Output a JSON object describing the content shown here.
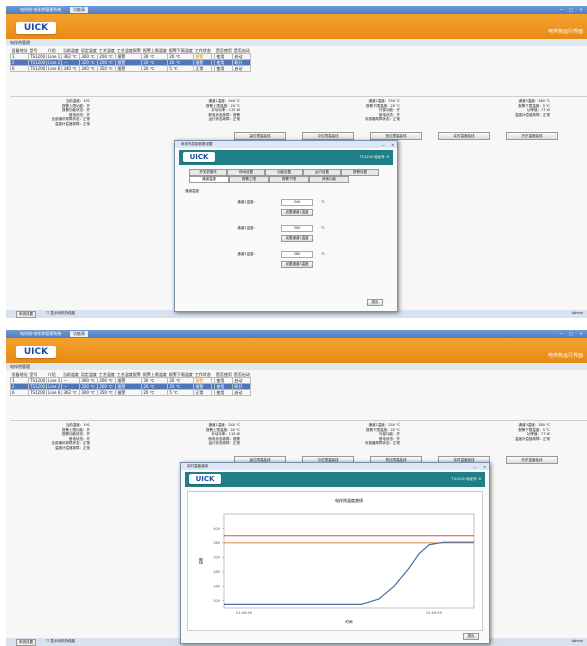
{
  "window": {
    "title": "电伴热·电伴热管理系统",
    "tab": "功能表",
    "controls": [
      "—",
      "□",
      "×"
    ]
  },
  "header": {
    "logo": "UICK",
    "right_text": "电伴热运行界面"
  },
  "page_label": "电伴热管理",
  "table": {
    "headers": [
      "设备地址",
      "型号",
      "介绍",
      "当前温度",
      "设定温度",
      "工艺温度",
      "工艺温度报警",
      "报警上限温度",
      "报警下限温度",
      "工作状态",
      "",
      "是否使用",
      "是否启动"
    ],
    "rows_1": [
      [
        "1",
        "TS1200",
        "Line 1",
        "362 ℃",
        "300 ℃",
        "200 ℃",
        "报警",
        "30 ℃",
        "20 ℃",
        "报警",
        "",
        "使用",
        "启动"
      ],
      [
        "2",
        "TS1200",
        "Line 2",
        "—",
        "320 ℃",
        "200 ℃",
        "报警",
        "20 ℃",
        "20 ℃",
        "报警",
        "",
        "使用",
        "断开"
      ],
      [
        "6",
        "TS1200",
        "Line 6",
        "340 ℃",
        "340 ℃",
        "350 ℃",
        "报警",
        "20 ℃",
        "5 ℃",
        "正常",
        "",
        "使用",
        "启动"
      ]
    ],
    "rows_2": [
      [
        "1",
        "TS1200",
        "Line 1",
        "—",
        "300 ℃",
        "200 ℃",
        "报警",
        "30 ℃",
        "20 ℃",
        "报警",
        "",
        "使用",
        "启动"
      ],
      [
        "2",
        "TS1200",
        "Line 2",
        "—",
        "320 ℃",
        "200 ℃",
        "报警",
        "20 ℃",
        "20 ℃",
        "报警",
        "",
        "使用",
        "断开"
      ],
      [
        "6",
        "TS1200",
        "Line 6",
        "362 ℃",
        "300 ℃",
        "350 ℃",
        "报警",
        "20 ℃",
        "5 ℃",
        "正常",
        "",
        "使用",
        "启动"
      ]
    ]
  },
  "detail": {
    "col1": [
      "当前温度：191",
      "报警上限功能：开",
      "报警功能状态：开",
      "断电状态：开",
      "全部通讯故障状态：正常",
      "温度补偿值故障：正常"
    ],
    "col2": [
      "通道1温度：340 ℃",
      "报警上限温度：20 ℃",
      "手动功率：115 W",
      "断电状态故障：报警",
      "运行状态故障：正常"
    ],
    "col3": [
      "通道2温度：250 ℃",
      "报警下限温度：20 ℃",
      "外部功能：开",
      "断电状态：开",
      "传感器故障状态：正常"
    ],
    "col4": [
      "通道3温度：380 ℃",
      "报警下限温度：5 ℃",
      "功率值：77 W",
      "温度补偿值故障：正常"
    ]
  },
  "buttons": [
    "高位限温曲线",
    "中位限温曲线",
    "低位限温曲线",
    "实时温度曲线",
    "历史温度曲线"
  ],
  "status": {
    "button": "系统设置",
    "checkbox": "显示电伴热线路",
    "user": "Admin"
  },
  "dialog1": {
    "title": "电伴热控制参数设置",
    "model": "TS1200 地址号: 6",
    "tabs_row1": [
      "开关机操作",
      "时间设置",
      "功能设置",
      "运行设置",
      "报警设置"
    ],
    "tabs_row2": [
      "通道温度",
      "报警上限",
      "报警下限",
      "其他功能"
    ],
    "section": "通道温度",
    "fields": [
      {
        "label": "通道1温度：",
        "value": "340",
        "unit": "℃",
        "button": "设置通道1温度"
      },
      {
        "label": "通道2温度：",
        "value": "350",
        "unit": "℃",
        "button": "设置通道2温度"
      },
      {
        "label": "通道3温度：",
        "value": "380",
        "unit": "℃",
        "button": "设置通道3温度"
      }
    ],
    "ok": "退出"
  },
  "dialog2": {
    "title": "实时温度曲线",
    "model": "TS1200 地址号: 6",
    "ok": "退出"
  },
  "chart_data": {
    "type": "line",
    "title": "电伴热温度曲线",
    "xlabel": "时间",
    "ylabel": "温度",
    "x_ticks": [
      "01:09:56",
      "01:09:59"
    ],
    "y_ticks": [
      200,
      240,
      280,
      320,
      360,
      400
    ],
    "ylim": [
      180,
      440
    ],
    "reference_lines": [
      {
        "value": 380,
        "color": "#e74c3c"
      },
      {
        "value": 360,
        "color": "#e8873a"
      }
    ],
    "series": [
      {
        "color": "#4a6fa5",
        "x": [
          0,
          0.55,
          0.62,
          0.68,
          0.74,
          0.78,
          0.82,
          0.88,
          1.0
        ],
        "y": [
          190,
          190,
          205,
          240,
          290,
          330,
          355,
          362,
          362
        ]
      }
    ]
  },
  "colors": {
    "orange": "#ef9820",
    "blue_bar": "#5a86c4",
    "teal": "#1f7f86",
    "selected_row": "#4f77b8"
  }
}
